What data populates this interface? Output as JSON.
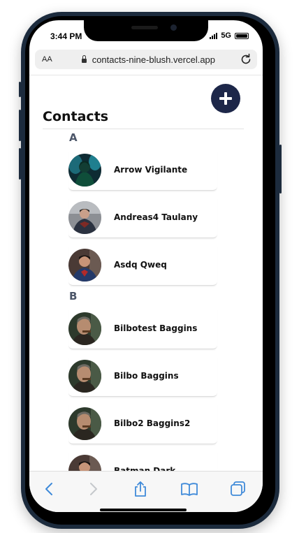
{
  "status_bar": {
    "time": "3:44 PM",
    "network": "5G"
  },
  "browser": {
    "text_size_label": "AA",
    "url": "contacts-nine-blush.vercel.app"
  },
  "page": {
    "title": "Contacts",
    "add_button_label": "+"
  },
  "groups": [
    {
      "letter": "A",
      "contacts": [
        "Arrow Vigilante",
        "Andreas4 Taulany",
        "Asdq Qweq"
      ]
    },
    {
      "letter": "B",
      "contacts": [
        "Bilbotest Baggins",
        "Bilbo Baggins",
        "Bilbo2 Baggins2",
        "Batman Dark"
      ]
    }
  ],
  "colors": {
    "accent": "#1d2749",
    "section_letter": "#4b5568",
    "toolbar_icons": "#3f8ad9"
  },
  "icons": {
    "back": "chevron-left-icon",
    "forward": "chevron-right-icon",
    "share": "share-icon",
    "bookmarks": "book-icon",
    "tabs": "tabs-icon"
  }
}
